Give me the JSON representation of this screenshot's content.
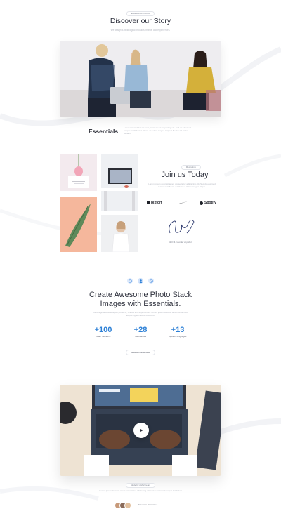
{
  "story": {
    "badge": "Established in 2012",
    "title": "Discover our Story",
    "subtitle": "We design & build digital products, brands and experiences."
  },
  "essentials": {
    "title": "Essentials",
    "text": "Lorem ipsum dolor sit amet, consectetur adipiscing elit. Sed do eiusmod tempor incididunt ut labore et dolore magna aliqua. Ut enim ad minim veniam."
  },
  "join": {
    "badge": "Recruiting",
    "title": "Join us Today",
    "text": "Lorem ipsum dolor sit amet, consectetur adipiscing elit. Sed do eiusmod tempor incididunt ut labore et dolore magna aliqua.",
    "brands": [
      "pixfort",
      "Nike",
      "Spotify"
    ],
    "signature_caption": "CEO & Founder at pixfort"
  },
  "features": {
    "title_line1": "Create Awesome Photo Stack",
    "title_line2": "Images with Essentials.",
    "text": "We design and build digital products, brands and experiences. Lorem ipsum dolor sit amet consectetur adipiscing elit sed do eiusmod.",
    "stats": [
      {
        "value": "+100",
        "label": "Team members"
      },
      {
        "value": "+28",
        "label": "Nationalities"
      },
      {
        "value": "+13",
        "label": "Spoken languages"
      }
    ],
    "button_label": "Make with Essentials"
  },
  "video": {
    "caption_badge": "Made by pixfort team",
    "footer_text": "Lorem ipsum dolor sit amet consectetur adipiscing elit sed do eiusmod tempor incididunt",
    "avatars_caption": "Join more awesome ›"
  },
  "colors": {
    "accent": "#2d80d6",
    "heading": "#2c2f3b",
    "muted": "#b7bac3"
  }
}
